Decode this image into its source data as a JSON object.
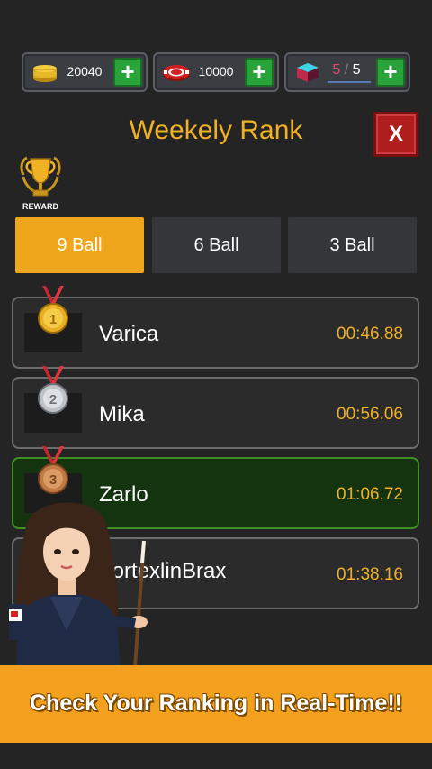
{
  "resources": {
    "coins": "20040",
    "chips": "10000",
    "cubes_current": "5",
    "cubes_max": "5",
    "cubes_separator": "/"
  },
  "title": "Weekely Rank",
  "close_label": "X",
  "reward_label": "REWARD",
  "tabs": [
    {
      "label": "9 Ball",
      "active": true
    },
    {
      "label": "6 Ball",
      "active": false
    },
    {
      "label": "3 Ball",
      "active": false
    }
  ],
  "rankings": [
    {
      "name": "Varica",
      "time": "00:46.88",
      "medal": "gold"
    },
    {
      "name": "Mika",
      "time": "00:56.06",
      "medal": "silver"
    },
    {
      "name": "Zarlo",
      "time": "01:06.72",
      "medal": "bronze"
    },
    {
      "name": "VortexlinBrax",
      "time": "01:38.16",
      "medal": "none"
    }
  ],
  "banner": "Check Your Ranking in Real-Time!!",
  "colors": {
    "accent": "#f0b125",
    "active_tab": "#efa51c",
    "highlight_row": "#14330f",
    "close": "#b01d1d",
    "plus": "#2aa33a"
  }
}
